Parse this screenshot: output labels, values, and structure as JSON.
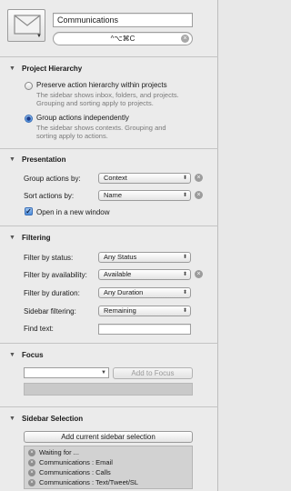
{
  "header": {
    "title_value": "Communications",
    "shortcut_value": "^⌥⌘C",
    "clear_glyph": "×",
    "icon": "envelope-icon"
  },
  "project_hierarchy": {
    "title": "Project Hierarchy",
    "options": [
      {
        "label": "Preserve action hierarchy within projects",
        "desc1": "The sidebar shows inbox, folders, and projects.",
        "desc2": "Grouping and sorting apply to projects.",
        "selected": false
      },
      {
        "label": "Group actions independently",
        "desc1": "The sidebar shows contexts. Grouping and",
        "desc2": "sorting apply to actions.",
        "selected": true
      }
    ]
  },
  "presentation": {
    "title": "Presentation",
    "group_label": "Group actions by:",
    "group_value": "Context",
    "sort_label": "Sort actions by:",
    "sort_value": "Name",
    "open_window_label": "Open in a new window",
    "open_window_checked": true
  },
  "filtering": {
    "title": "Filtering",
    "status_label": "Filter by status:",
    "status_value": "Any Status",
    "availability_label": "Filter by availability:",
    "availability_value": "Available",
    "duration_label": "Filter by duration:",
    "duration_value": "Any Duration",
    "sidebar_label": "Sidebar filtering:",
    "sidebar_value": "Remaining",
    "find_label": "Find text:",
    "find_value": ""
  },
  "focus": {
    "title": "Focus",
    "combo_value": "",
    "add_button": "Add to Focus"
  },
  "sidebar_selection": {
    "title": "Sidebar Selection",
    "add_button": "Add current sidebar selection",
    "items": [
      "Waiting for ...",
      "Communications : Email",
      "Communications : Calls",
      "Communications : Text/Tweet/SL"
    ]
  },
  "glyphs": {
    "disclosure_open": "▼",
    "popup_arrows": "⬍",
    "combo_arrow": "▼",
    "check": "✓",
    "remove": "×"
  },
  "colors": {
    "accent": "#4d8edc",
    "panel_bg": "#ebebeb"
  }
}
